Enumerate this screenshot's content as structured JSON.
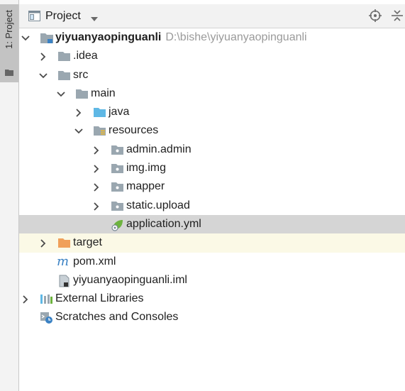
{
  "sidebar": {
    "tab_label": "1: Project"
  },
  "header": {
    "title": "Project",
    "icons": [
      "project-view-icon",
      "chevron-down-icon",
      "locate-target-icon",
      "collapse-all-icon"
    ]
  },
  "tree": {
    "root": {
      "name": "yiyuanyaopinguanli",
      "path": "D:\\bishe\\yiyuanyaopinguanli"
    },
    "idea": ".idea",
    "src": "src",
    "main": "main",
    "java": "java",
    "resources": "resources",
    "admin": "admin.admin",
    "img": "img.img",
    "mapper": "mapper",
    "static_upload": "static.upload",
    "application": "application.yml",
    "target": "target",
    "pom": "pom.xml",
    "iml": "yiyuanyaopinguanli.iml",
    "libraries": "External Libraries",
    "scratches": "Scratches and Consoles"
  },
  "colors": {
    "selected_row": "#d5d5d5",
    "excluded_row": "#fbf9e6",
    "folder_gray": "#9aa7b0",
    "java_folder": "#5fb8e5",
    "target_folder": "#f0a05a",
    "spring_green": "#6db33f",
    "maven_blue": "#3b82c4"
  }
}
